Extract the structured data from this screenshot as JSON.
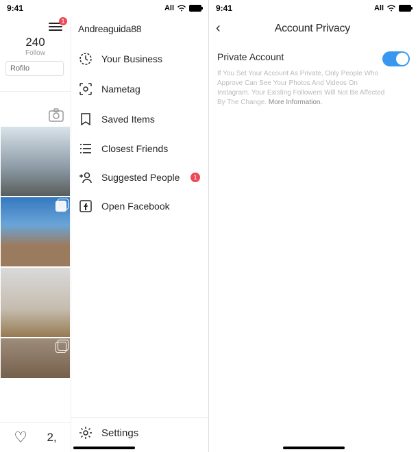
{
  "status": {
    "time": "9:41",
    "carrier": "All"
  },
  "left": {
    "username": "Andreaguida88",
    "hamburger_badge": "1",
    "stats": {
      "count": "240",
      "label": "Follow"
    },
    "filter_input": "Rofilo",
    "bottom_count": "2,",
    "drawer": {
      "items": [
        {
          "key": "your-business",
          "label": "Your Business"
        },
        {
          "key": "nametag",
          "label": "Nametag"
        },
        {
          "key": "saved",
          "label": "Saved Items"
        },
        {
          "key": "close-friends",
          "label": "Closest Friends"
        },
        {
          "key": "suggested",
          "label": "Suggested People",
          "badge": "1"
        },
        {
          "key": "open-facebook",
          "label": "Open Facebook"
        }
      ],
      "footer": "Settings"
    }
  },
  "right": {
    "title": "Account Privacy",
    "setting": {
      "label": "Private Account",
      "enabled": true,
      "description_main": "If You Set Your Account As Private, Only People Who Approve Can See Your Photos And Videos On Instagram. Your Existing Followers Will Not Be Affected By The Change.",
      "description_more": "More Information."
    }
  }
}
